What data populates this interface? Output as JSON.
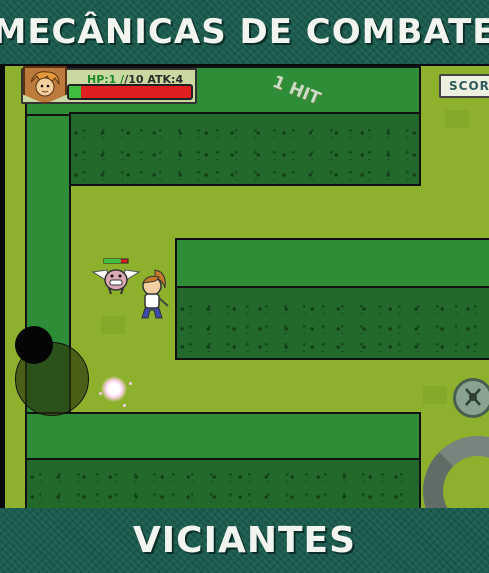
{
  "banner_top": {
    "text": "MECÂNICAS DE COMBATE"
  },
  "banner_bottom": {
    "text": "VICIANTES"
  },
  "hud": {
    "hp_label": "HP:",
    "hp_current": "1",
    "hp_max": "/10",
    "atk_label": "ATK:",
    "atk_value": "4",
    "hp_fraction": 0.1
  },
  "hit_text": "1 HIT",
  "score_label": "SCORE",
  "enemy_health_fraction": 0.7,
  "colors": {
    "banner": "#1a5b4d",
    "grass": "#8db12c",
    "hedge": "#2e8d37",
    "hp_bar": "#e02020",
    "hp_fill": "#3fbf3f"
  },
  "icons": [
    "hero-portrait-icon",
    "sword-icon",
    "winged-pig-enemy-icon",
    "player-hero-icon",
    "skill-button-icon",
    "stone-portal-icon"
  ]
}
